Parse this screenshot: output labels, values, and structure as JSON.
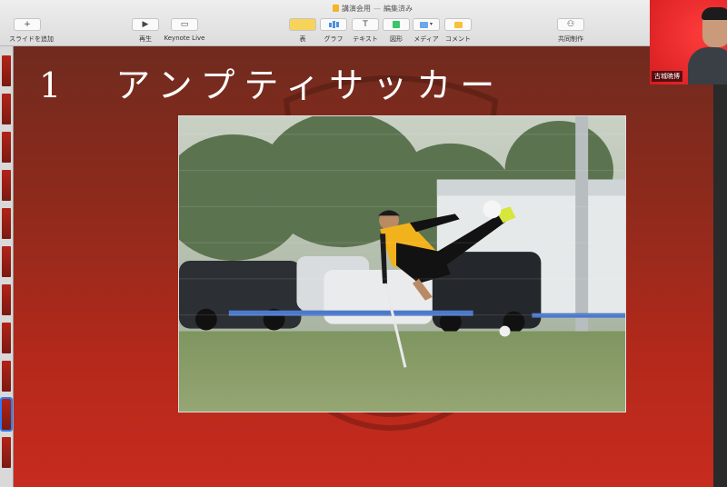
{
  "window": {
    "doc_title": "講演会用",
    "doc_status": "編集済み"
  },
  "toolbar": {
    "add_slide_label": "スライドを追加",
    "play_label": "再生",
    "keynote_live_label": "Keynote Live",
    "table_label": "表",
    "chart_label": "グラフ",
    "text_label": "テキスト",
    "shape_label": "図形",
    "media_label": "メディア",
    "comment_label": "コメント",
    "collaborate_label": "共同制作",
    "text_button_glyph": "T"
  },
  "slide": {
    "number": "1",
    "title": "アンプティサッカー",
    "photo_icon": "amputee-soccer-photo"
  },
  "video": {
    "participant_name": "古城暁博"
  },
  "colors": {
    "slide_top": "#6f2b1e",
    "slide_bottom": "#c72b1e",
    "video_bg": "#e8262a",
    "selection": "#2f7bf5"
  }
}
